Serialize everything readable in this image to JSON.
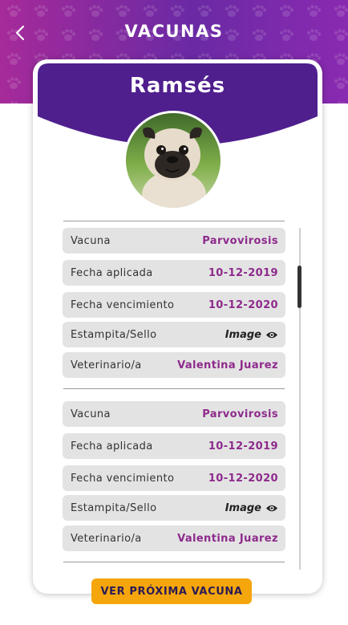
{
  "header": {
    "title": "VACUNAS",
    "back_icon": "chevron-left-icon",
    "gradient_colors": [
      "#a62a9a",
      "#6a2aa4",
      "#8a2ab0"
    ]
  },
  "pet": {
    "name": "Ramsés",
    "avatar": "pug-dog-photo"
  },
  "records": [
    {
      "vaccine_label": "Vacuna",
      "vaccine_value": "Parvovirosis",
      "applied_label": "Fecha aplicada",
      "applied_value": "10-12-2019",
      "expiry_label": "Fecha vencimiento",
      "expiry_value": "10-12-2020",
      "stamp_label": "Estampita/Sello",
      "stamp_value": "Image",
      "vet_label": "Veterinario/a",
      "vet_value": "Valentina Juarez"
    },
    {
      "vaccine_label": "Vacuna",
      "vaccine_value": "Parvovirosis",
      "applied_label": "Fecha aplicada",
      "applied_value": "10-12-2019",
      "expiry_label": "Fecha vencimiento",
      "expiry_value": "10-12-2020",
      "stamp_label": "Estampita/Sello",
      "stamp_value": "Image",
      "vet_label": "Veterinario/a",
      "vet_value": "Valentina Juarez"
    }
  ],
  "actions": {
    "next_vaccine_label": "VER PRÓXIMA VACUNA"
  },
  "colors": {
    "accent_purple": "#4f1f8e",
    "value_text": "#8e2a8c",
    "button": "#f4a60c"
  }
}
